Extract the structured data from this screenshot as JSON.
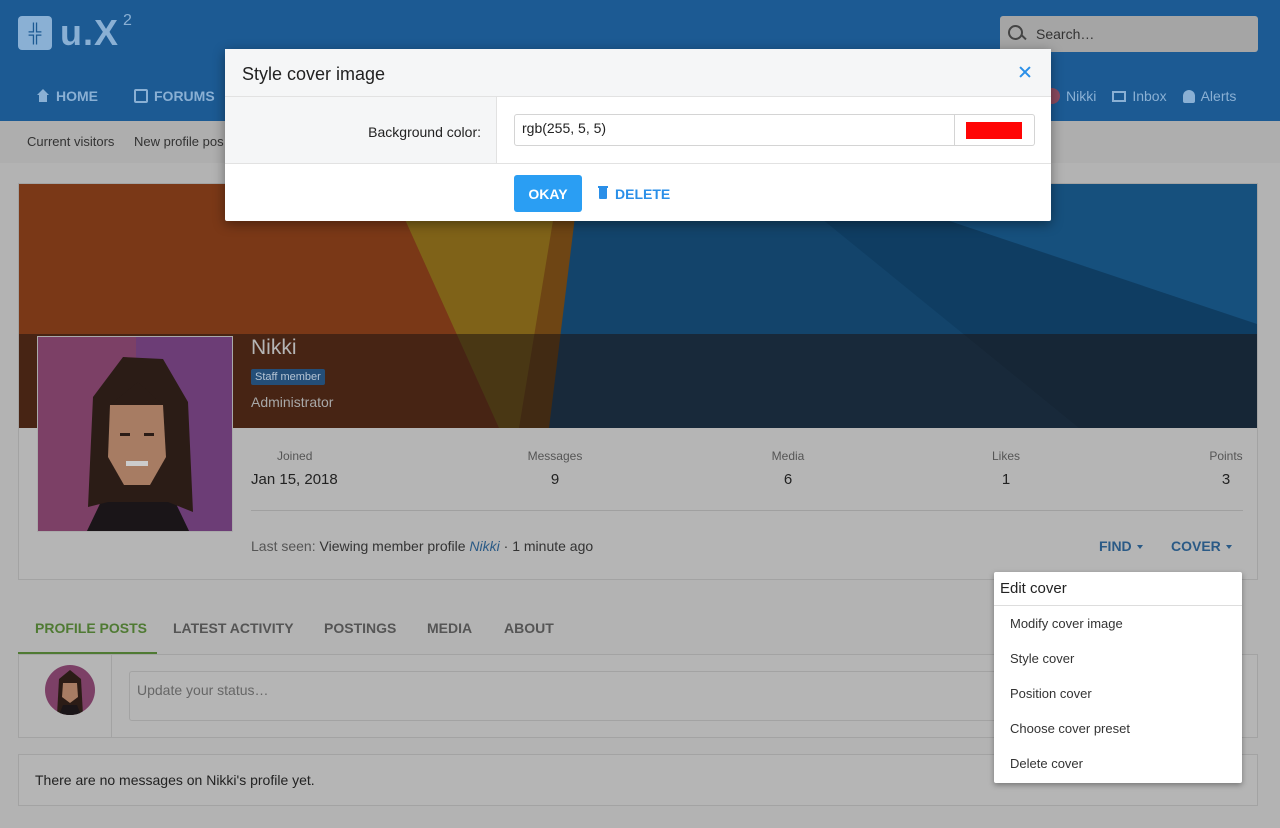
{
  "header": {
    "logo_glyph": "╬",
    "logo_text": "u.X",
    "logo_sup": "2",
    "search_placeholder": "Search…",
    "nav": [
      {
        "label": "HOME",
        "icon": "home-icon"
      },
      {
        "label": "FORUMS",
        "icon": "forum-icon"
      }
    ],
    "user_nav": {
      "user": "Nikki",
      "inbox": "Inbox",
      "alerts": "Alerts"
    }
  },
  "subnav": [
    "Current visitors",
    "New profile pos"
  ],
  "profile": {
    "name": "Nikki",
    "badge": "Staff member",
    "role": "Administrator",
    "stats": [
      {
        "label": "Joined",
        "value": "Jan 15, 2018"
      },
      {
        "label": "Messages",
        "value": "9"
      },
      {
        "label": "Media",
        "value": "6"
      },
      {
        "label": "Likes",
        "value": "1"
      },
      {
        "label": "Points",
        "value": "3"
      }
    ],
    "last_seen_label": "Last seen:",
    "last_seen_activity": "Viewing member profile",
    "last_seen_link": "Nikki",
    "last_seen_time": "· 1 minute ago",
    "find_label": "FIND",
    "cover_label": "COVER"
  },
  "tabs": [
    "PROFILE POSTS",
    "LATEST ACTIVITY",
    "POSTINGS",
    "MEDIA",
    "ABOUT"
  ],
  "status_placeholder": "Update your status…",
  "empty_message": "There are no messages on Nikki's profile yet.",
  "dropdown": {
    "header": "Edit cover",
    "items": [
      "Modify cover image",
      "Style cover",
      "Position cover",
      "Choose cover preset",
      "Delete cover"
    ]
  },
  "modal": {
    "title": "Style cover image",
    "label": "Background color:",
    "color_value": "rgb(255, 5, 5)",
    "swatch_color": "#ff0505",
    "okay_label": "OKAY",
    "delete_label": "DELETE"
  },
  "colors": {
    "accent": "#2a9ef3",
    "tab_active": "#4f7a33",
    "header": "#1c5a93"
  }
}
